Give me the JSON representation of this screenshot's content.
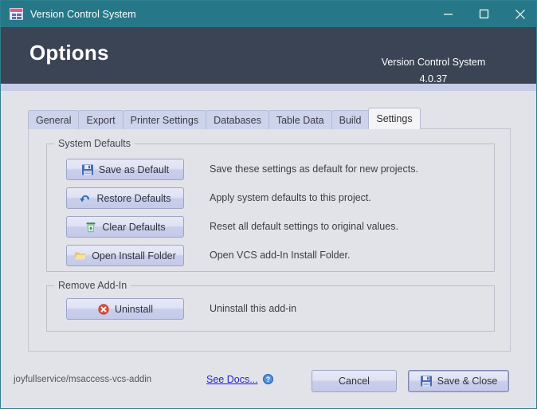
{
  "window": {
    "title": "Version Control System",
    "icon": "access-table-icon",
    "controls": [
      {
        "name": "minimize",
        "glyph": "minimize-icon"
      },
      {
        "name": "maximize",
        "glyph": "maximize-icon"
      },
      {
        "name": "close",
        "glyph": "close-icon"
      }
    ]
  },
  "header": {
    "title": "Options",
    "product": "Version Control System",
    "version": "4.0.37"
  },
  "tabs": [
    {
      "label": "General",
      "active": false
    },
    {
      "label": "Export",
      "active": false
    },
    {
      "label": "Printer Settings",
      "active": false
    },
    {
      "label": "Databases",
      "active": false
    },
    {
      "label": "Table Data",
      "active": false
    },
    {
      "label": "Build",
      "active": false
    },
    {
      "label": "Settings",
      "active": true
    }
  ],
  "groups": {
    "system_defaults": {
      "legend": "System Defaults",
      "rows": [
        {
          "button": "Save as Default",
          "icon": "floppy-disk-save-icon",
          "description": "Save these settings as default for new projects."
        },
        {
          "button": "Restore Defaults",
          "icon": "undo-arrow-icon",
          "description": "Apply system defaults to this project."
        },
        {
          "button": "Clear Defaults",
          "icon": "trash-bin-icon",
          "description": "Reset all default settings to original values."
        },
        {
          "button": "Open Install Folder",
          "icon": "folder-open-icon",
          "description": "Open VCS add-In Install Folder."
        }
      ]
    },
    "remove_addin": {
      "legend": "Remove Add-In",
      "rows": [
        {
          "button": "Uninstall",
          "icon": "red-circle-x-icon",
          "description": "Uninstall this add-in"
        }
      ]
    }
  },
  "footer": {
    "credit": "joyfullservice/msaccess-vcs-addin",
    "docs_link": "See Docs...",
    "docs_icon": "help-question-icon",
    "cancel_label": "Cancel",
    "save_close_label": "Save & Close",
    "save_close_icon": "floppy-disk-save-icon"
  },
  "colors": {
    "titlebar": "#267889",
    "header_band": "#3a4454",
    "strip": "#c6cce6",
    "body": "#e2e3e9",
    "tab_inactive": "#ccd3ea",
    "tab_active": "#f4f4f6",
    "link": "#2424c8",
    "uninstall_icon": "#c9372c",
    "accent_icon_pink": "#e8568f"
  }
}
